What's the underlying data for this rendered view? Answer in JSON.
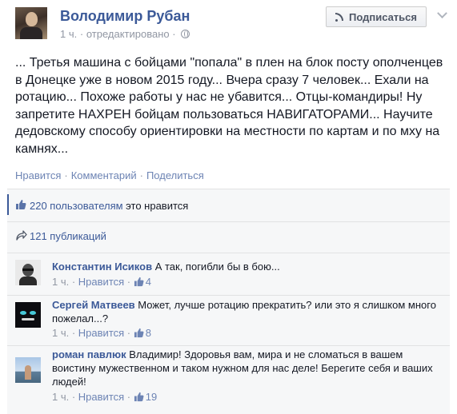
{
  "post": {
    "author": "Володимир Рубан",
    "time": "1 ч.",
    "edited": "отредактировано",
    "separator": "·",
    "subscribe_label": "Подписаться",
    "text": "... Третья машина с бойцами \"попала\" в плен на блок посту ополченцев в Донецке уже в новом 2015 году... Вчера сразу 7 человек... Ехали на ротацию... Похоже работы у нас не убавится... Отцы-командиры! Ну запретите НАХРЕН бойцам пользоваться НАВИГАТОРАМИ... Научите дедовскому способу ориентировки на местности по картам и по мху на камнях...",
    "actions": {
      "like": "Нравится",
      "comment": "Комментарий",
      "share": "Поделиться"
    }
  },
  "likes": {
    "count_link": "220 пользователям",
    "suffix": " это нравится"
  },
  "shares": {
    "label": "121 публикаций"
  },
  "comments": [
    {
      "author": "Константин Исиков",
      "text": "А так, погибли бы в бою...",
      "time": "1 ч.",
      "like_label": "Нравится",
      "likes": "4"
    },
    {
      "author": "Сергей Матвеев",
      "text": "Может, лучше ротацию прекратить? или это я слишком много пожелал...?",
      "time": "1 ч.",
      "like_label": "Нравится",
      "likes": "8"
    },
    {
      "author": "роман павлюк",
      "text": "Владимир! Здоровья вам, мира и не сломаться в вашем воистину мужественном и таком нужном для нас деле! Берегите себя и ваших людей!",
      "time": "1 ч.",
      "like_label": "Нравится",
      "likes": "19"
    }
  ],
  "colors": {
    "link": "#3b5998",
    "muted": "#9197a3",
    "feedback_bg": "#f6f7f8"
  },
  "icons": [
    "rss-icon",
    "chevron-down-icon",
    "globe-icon",
    "thumbs-up-icon",
    "share-icon"
  ]
}
